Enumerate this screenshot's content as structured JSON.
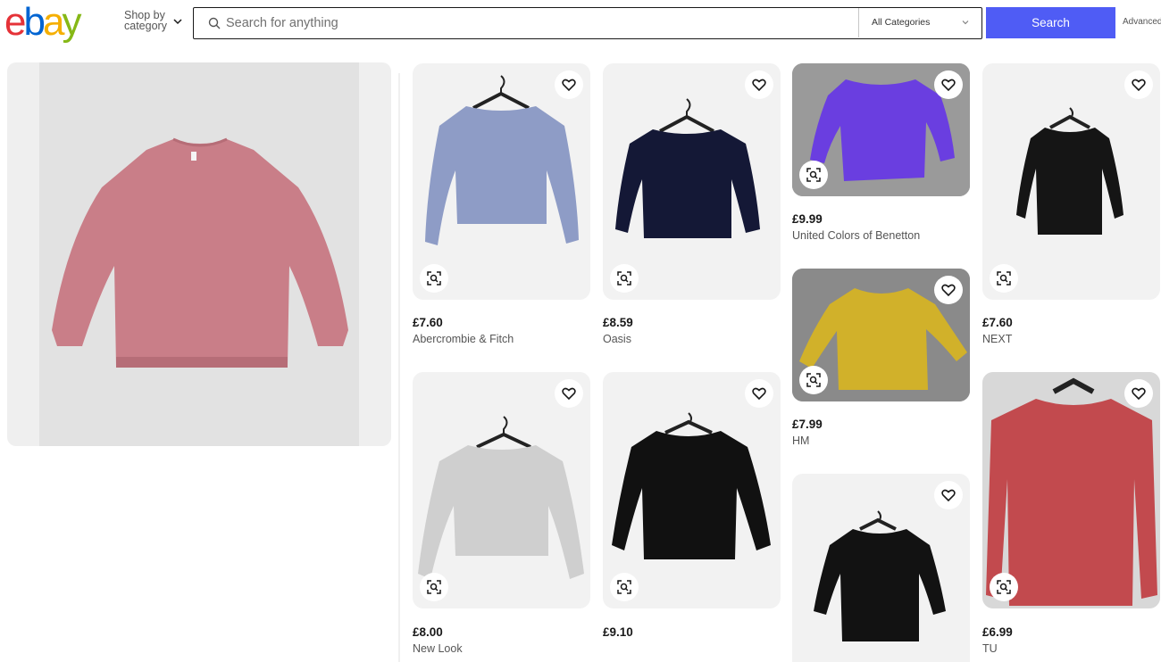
{
  "header": {
    "logo_letters": [
      "e",
      "b",
      "a",
      "y"
    ],
    "logo_colors": [
      "#e53238",
      "#0064d2",
      "#f5af02",
      "#86b817"
    ],
    "shop_by_label": "Shop by category",
    "search_placeholder": "Search for anything",
    "category_select": "All Categories",
    "search_button": "Search",
    "advanced_link": "Advanced"
  },
  "hero": {
    "item_color": "#c97e88",
    "icon": "pink-sweater-image"
  },
  "products": [
    {
      "price": "£7.60",
      "brand": "Abercrombie & Fitch",
      "color": "#8e9cc6",
      "background": "#f2f2f2"
    },
    {
      "price": "£8.59",
      "brand": "Oasis",
      "color": "#141836",
      "background": "#f2f2f2"
    },
    {
      "price": "£9.99",
      "brand": "United Colors of Benetton",
      "color": "#6a3ee0",
      "background": "#9a9a9a"
    },
    {
      "price": "£7.60",
      "brand": "NEXT",
      "color": "#151515",
      "background": "#f2f2f2"
    },
    {
      "price": "£7.99",
      "brand": "HM",
      "color": "#d1b12a",
      "background": "#8a8a8a"
    },
    {
      "price": "£8.00",
      "brand": "New Look",
      "color": "#cfcfcf",
      "background": "#f2f2f2"
    },
    {
      "price": "£9.10",
      "brand": "",
      "color": "#111111",
      "background": "#f2f2f2"
    },
    {
      "price": "",
      "brand": "",
      "color": "#121212",
      "background": "#f2f2f2"
    },
    {
      "price": "£6.99",
      "brand": "TU",
      "color": "#c24a4e",
      "background": "#d8d8d8"
    }
  ],
  "colors": {
    "accent": "#4f5cf5",
    "card_bg": "#f2f2f2"
  }
}
